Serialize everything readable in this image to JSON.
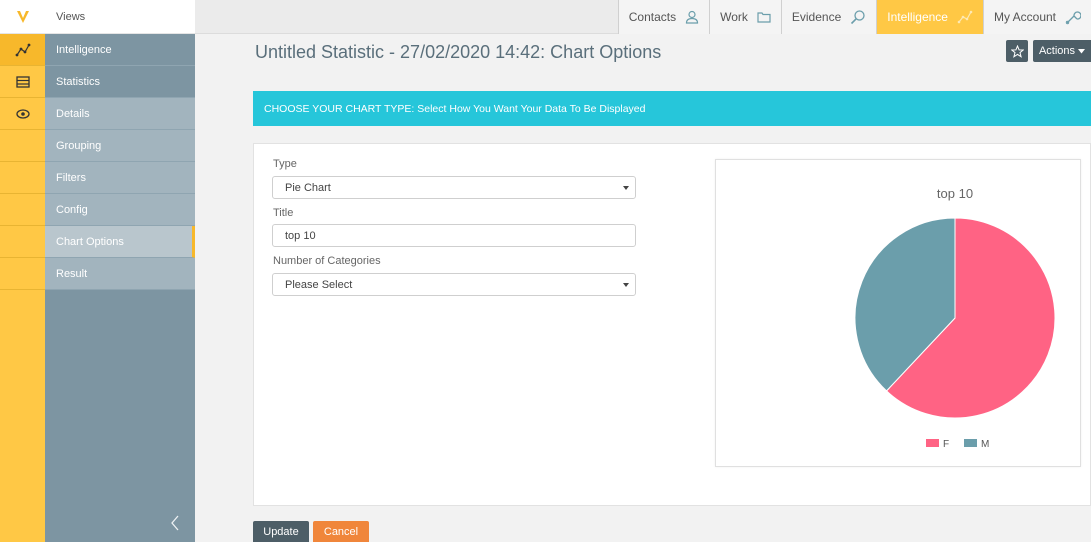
{
  "sidebar": {
    "views_label": "Views",
    "items": [
      {
        "label": "Intelligence",
        "icon": "line-chart-icon"
      },
      {
        "label": "Statistics",
        "icon": "table-icon"
      },
      {
        "label": "Details",
        "icon": "eye-icon"
      },
      {
        "label": "Grouping"
      },
      {
        "label": "Filters"
      },
      {
        "label": "Config"
      },
      {
        "label": "Chart Options"
      },
      {
        "label": "Result"
      }
    ],
    "collapse_glyph": "<"
  },
  "topnav": {
    "items": [
      {
        "label": "Contacts",
        "icon": "person-icon"
      },
      {
        "label": "Work",
        "icon": "folder-icon"
      },
      {
        "label": "Evidence",
        "icon": "magnifier-icon"
      },
      {
        "label": "Intelligence",
        "icon": "line-chart-icon"
      },
      {
        "label": "My Account",
        "icon": "wrench-icon"
      }
    ]
  },
  "page": {
    "title": "Untitled Statistic - 27/02/2020 14:42: Chart Options",
    "actions_label": "Actions",
    "banner": "CHOOSE YOUR CHART TYPE: Select How You Want Your Data To Be Displayed"
  },
  "form": {
    "type_label": "Type",
    "type_value": "Pie Chart",
    "title_label": "Title",
    "title_value": "top 10",
    "categories_label": "Number of Categories",
    "categories_value": "Please Select"
  },
  "buttons": {
    "update": "Update",
    "cancel": "Cancel"
  },
  "colors": {
    "accent_yellow": "#ffc845",
    "banner_cyan": "#26c6da",
    "nav_slate": "#7d95a2",
    "button_dark": "#4d5e67",
    "cancel_orange": "#f0863b"
  },
  "chart_data": {
    "type": "pie",
    "title": "top 10",
    "categories": [
      "F",
      "M"
    ],
    "values": [
      62,
      38
    ],
    "colors": [
      "#ff6384",
      "#6b9eab"
    ],
    "legend": "bottom"
  }
}
